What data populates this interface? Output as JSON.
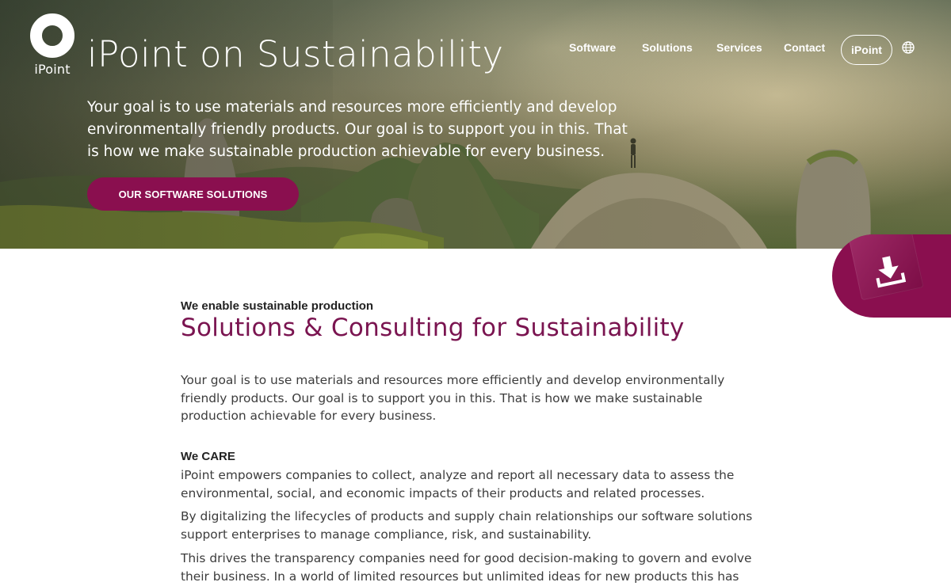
{
  "brand": {
    "logo_text": "iPoint",
    "accent_color": "#8a0f4f",
    "title_color": "#7a1450"
  },
  "nav": {
    "items": [
      "Software",
      "Solutions",
      "Services",
      "Contact"
    ],
    "pill_label": "iPoint",
    "language_icon": "globe-icon"
  },
  "hero": {
    "title": "iPoint on Sustainability",
    "description": "Your goal is to use materials and resources more efficiently and develop environmentally friendly products. Our goal is to support you in this. That is how we make sustainable production achievable for every business.",
    "cta_label": "OUR SOFTWARE SOLUTIONS"
  },
  "download_tab": {
    "icon": "download-icon"
  },
  "main": {
    "kicker": "We enable sustainable production",
    "title": "Solutions & Consulting for Sustainability",
    "intro": "Your goal is to use materials and resources more efficiently and develop environmentally friendly products. Our goal is to support you in this. That is how we make sustainable production achievable for every business.",
    "subhead": "We CARE",
    "paragraphs": [
      "iPoint empowers companies to collect, analyze and report all necessary data to assess the environmental, social, and economic impacts of their products and related processes.",
      "By digitalizing the lifecycles of products and supply chain relationships our software solutions support enterprises to manage compliance, risk, and sustainability.",
      "This drives the transparency companies need for good decision-making to govern and evolve their business. In a world of limited resources but unlimited ideas for new products this has become a"
    ]
  }
}
